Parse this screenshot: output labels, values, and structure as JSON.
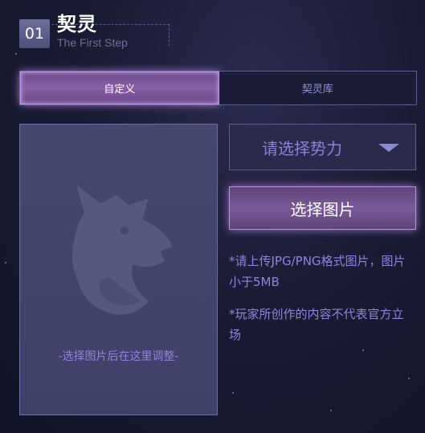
{
  "header": {
    "step_number": "01",
    "title": "契灵",
    "subtitle": "The First Step"
  },
  "tabs": [
    {
      "label": "自定义",
      "active": true
    },
    {
      "label": "契灵库",
      "active": false
    }
  ],
  "image_area": {
    "hint": "-选择图片后在这里调整-",
    "placeholder_icon": "wolf-icon"
  },
  "faction_select": {
    "label": "请选择势力",
    "icon": "chevron-down-icon"
  },
  "choose_image_button": {
    "label": "选择图片"
  },
  "notes": [
    "*请上传JPG/PNG格式图片，图片小于5MB",
    "*玩家所创作的内容不代表官方立场"
  ],
  "colors": {
    "accent": "#8a5fa8",
    "text_purple": "#8f84e0",
    "background": "#1a1b34"
  }
}
